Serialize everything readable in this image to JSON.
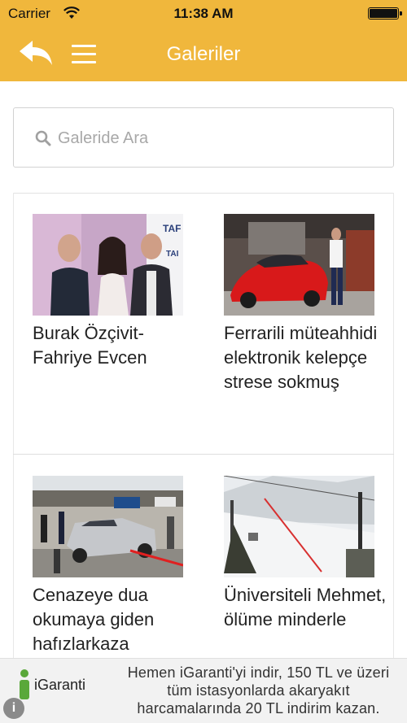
{
  "status_bar": {
    "carrier": "Carrier",
    "time": "11:38 AM"
  },
  "nav": {
    "title": "Galeriler",
    "back_icon": "back-arrow-icon",
    "menu_icon": "hamburger-menu-icon"
  },
  "search": {
    "placeholder": "Galeride Ara",
    "value": "",
    "icon": "search-icon"
  },
  "gallery": {
    "items": [
      {
        "title": "Burak Özçivit-Fahriye Evcen"
      },
      {
        "title": "Ferrarili müteahhidi elektronik kelepçe strese sokmuş"
      },
      {
        "title": "Cenazeye dua okumaya giden hafızlarkaza"
      },
      {
        "title": "Üniversiteli Mehmet, ölüme minderle"
      }
    ]
  },
  "ad": {
    "brand": "iGaranti",
    "text": "Hemen iGaranti'yi indir, 150 TL ve üzeri tüm istasyonlarda akaryakıt harcamalarında 20 TL indirim kazan.",
    "info_icon": "info-icon"
  },
  "colors": {
    "nav_background": "#f0b73c",
    "nav_text": "#ffffff",
    "ad_brand_green": "#5aa83a"
  }
}
